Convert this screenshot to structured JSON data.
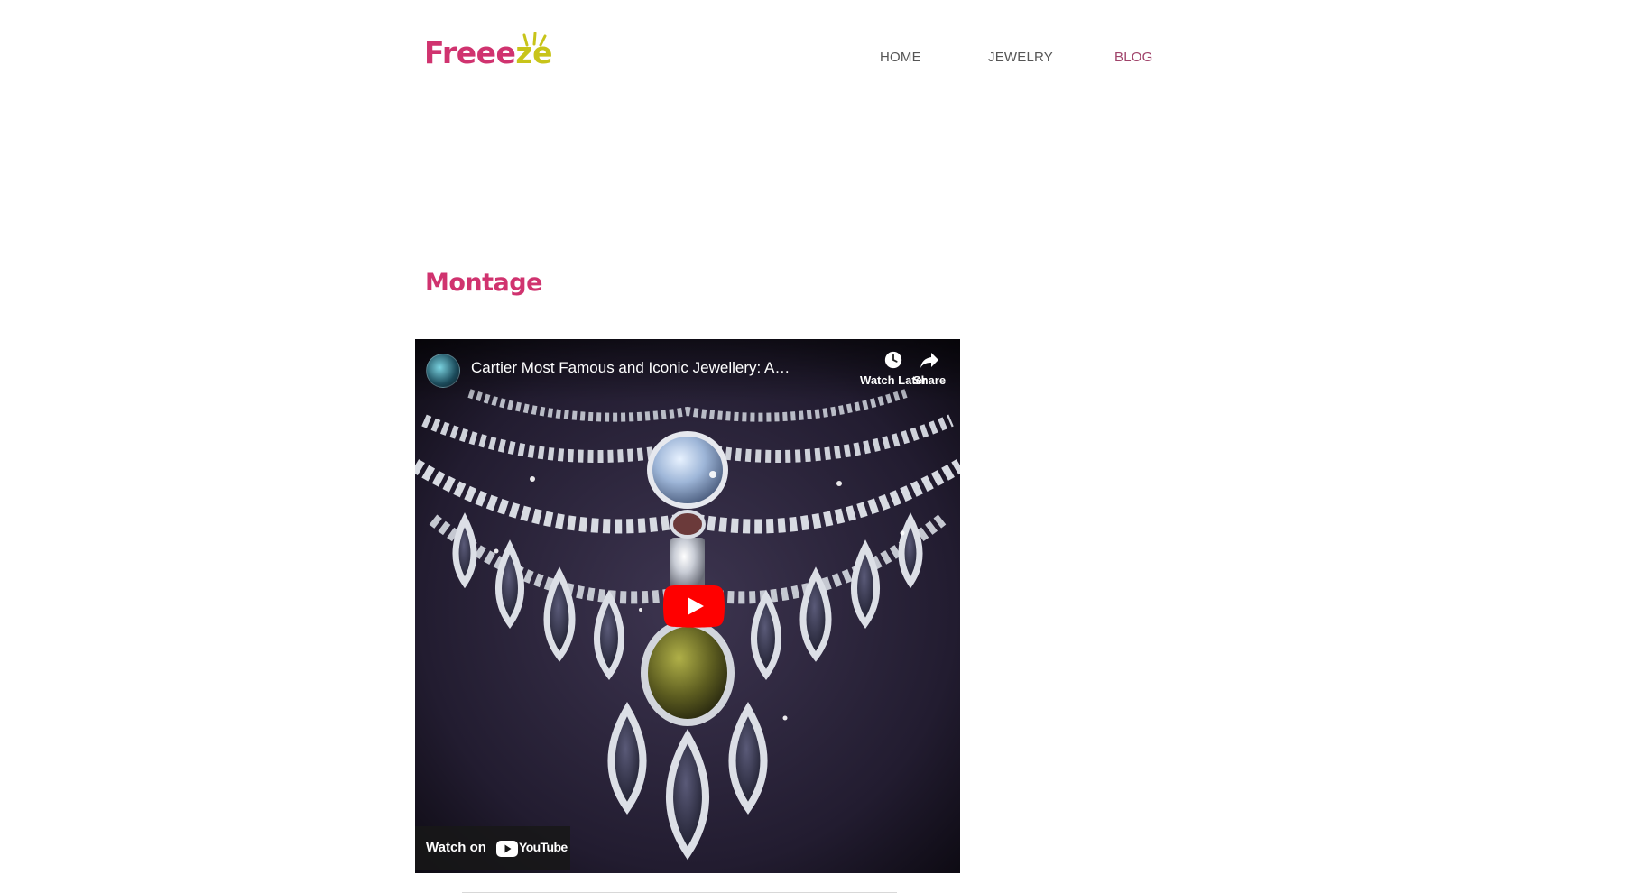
{
  "brand": {
    "name_main": "Freee",
    "name_accent": "ze",
    "primary_color": "#d0336f",
    "accent_color": "#c8c41a"
  },
  "nav": {
    "items": [
      {
        "label": "HOME"
      },
      {
        "label": "JEWELRY"
      },
      {
        "label": "BLOG",
        "active": true
      }
    ],
    "text_color": "#555555",
    "active_color": "#a0436a"
  },
  "page": {
    "title": "Montage"
  },
  "video": {
    "title": "Cartier Most Famous and Iconic Jewellery: A…",
    "watch_later_label": "Watch Later",
    "share_label": "Share",
    "watch_on_label": "Watch on",
    "youtube_label": "YouTube",
    "icons": {
      "watch_later": "clock-icon",
      "share": "share-arrow-icon",
      "play": "play-icon",
      "youtube": "youtube-logo-icon"
    },
    "play_color": "#ff0000"
  }
}
